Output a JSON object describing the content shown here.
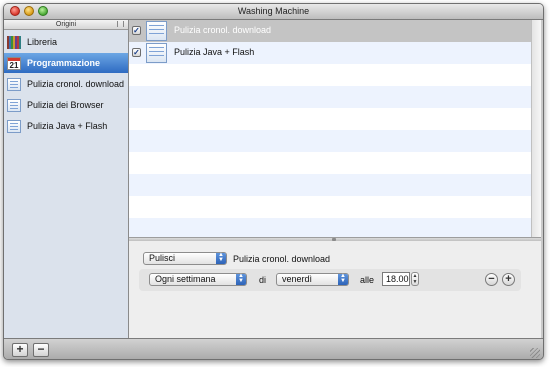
{
  "window": {
    "title": "Washing Machine"
  },
  "sidebar": {
    "header": "Origini",
    "items": [
      {
        "label": "Libreria",
        "icon": "library-books-icon",
        "selected": false
      },
      {
        "label": "Programmazione",
        "icon": "calendar-icon",
        "icon_text": "21",
        "selected": true
      },
      {
        "label": "Pulizia cronol. download",
        "icon": "list-document-icon",
        "selected": false
      },
      {
        "label": "Pulizia dei Browser",
        "icon": "list-document-icon",
        "selected": false
      },
      {
        "label": "Pulizia Java + Flash",
        "icon": "list-document-icon",
        "selected": false
      }
    ]
  },
  "schedule_list": {
    "rows": [
      {
        "label": "Pulizia cronol. download",
        "checked": true,
        "selected": true
      },
      {
        "label": "Pulizia Java + Flash",
        "checked": true,
        "selected": false
      }
    ]
  },
  "editor": {
    "action_popup": "Pulisci",
    "target_label": "Pulizia cronol. download",
    "frequency_popup": "Ogni settimana",
    "di_label": "di",
    "day_popup": "venerdì",
    "alle_label": "alle",
    "time_value": "18.00"
  },
  "colors": {
    "selection_blue": "#2e6bc2",
    "popup_arrow_blue": "#2d63b8",
    "row_alternate": "#edf3fe",
    "row_selected": "#c4c4c4"
  }
}
